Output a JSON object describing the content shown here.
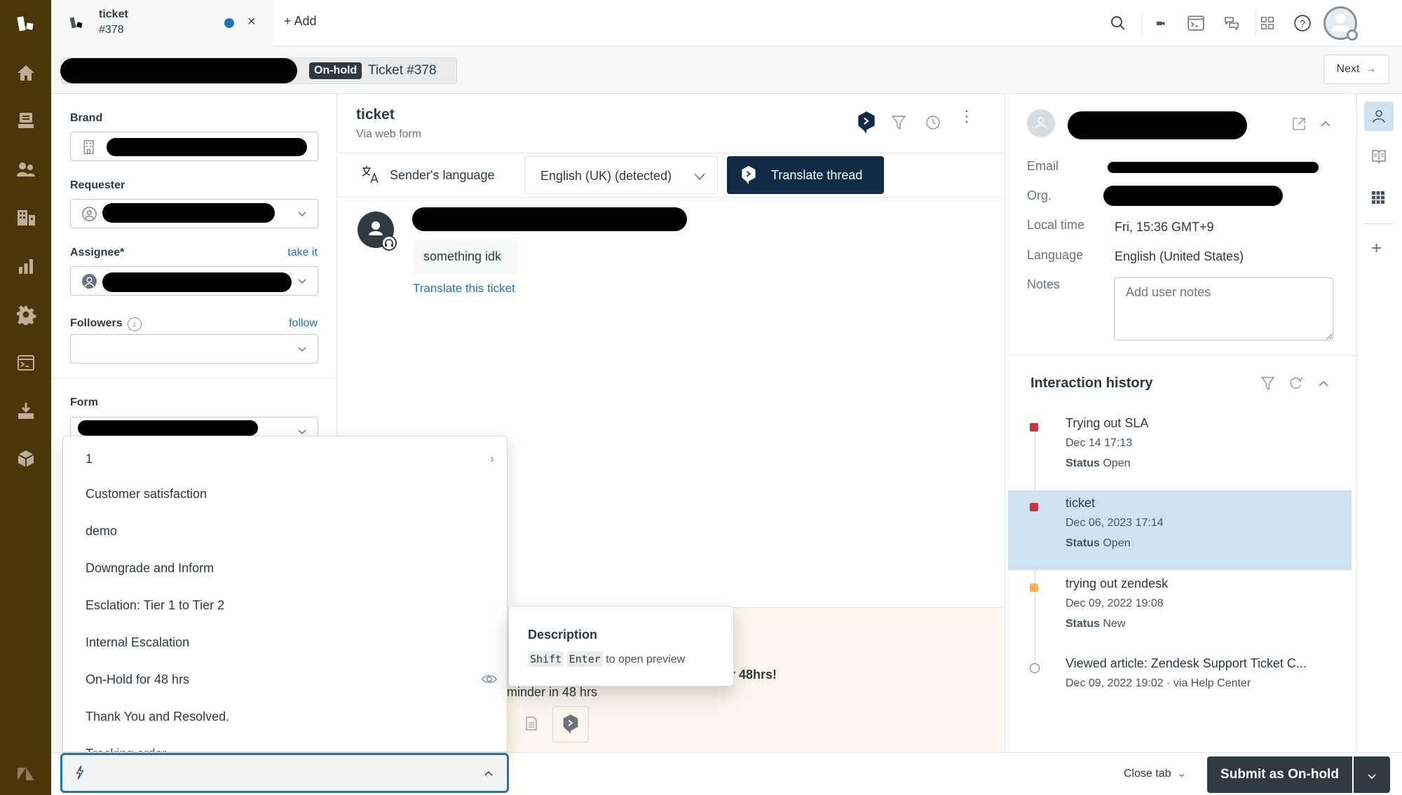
{
  "app": {
    "tab": {
      "title": "ticket",
      "number": "#378",
      "unsaved_indicator_color": "#1f73b7"
    },
    "add_label": "Add"
  },
  "nav": {
    "items": [
      "home-icon",
      "views-icon",
      "customers-icon",
      "organizations-icon",
      "reporting-icon",
      "admin-icon",
      "console-icon",
      "import-icon",
      "apps-icon"
    ],
    "bg_color": "#4a3609"
  },
  "topbar": {
    "icons": [
      "search-icon",
      "video-icon",
      "terminal-icon",
      "conversations-icon",
      "product-grid-icon",
      "help-icon",
      "profile-avatar"
    ]
  },
  "subbar": {
    "status_badge": "On-hold",
    "ticket_label": "Ticket #378",
    "next_label": "Next"
  },
  "props": {
    "brand_label": "Brand",
    "requester_label": "Requester",
    "assignee_label": "Assignee*",
    "take_it": "take it",
    "followers_label": "Followers",
    "follow": "follow",
    "form_label": "Form"
  },
  "conversation": {
    "title": "ticket",
    "via": "Via web form",
    "translate_bar": {
      "sender_language_label": "Sender's language",
      "detected_language": "English (UK) (detected)",
      "translate_thread": "Translate thread"
    },
    "message": {
      "body": "something idk",
      "translate_link": "Translate this ticket"
    },
    "composer": {
      "partial_bold": "r 48hrs!",
      "partial_text": "minder in 48 hrs"
    }
  },
  "macro_menu": {
    "items": [
      {
        "label": "1",
        "has_submenu": true
      },
      {
        "label": "Customer satisfaction"
      },
      {
        "label": "demo"
      },
      {
        "label": "Downgrade and Inform"
      },
      {
        "label": "Esclation: Tier 1 to Tier 2"
      },
      {
        "label": "Internal Escalation"
      },
      {
        "label": "On-Hold for 48 hrs",
        "hovered": true
      },
      {
        "label": "Thank You and Resolved."
      },
      {
        "label": "Tracking order"
      }
    ],
    "input_value": ""
  },
  "tooltip": {
    "title": "Description",
    "key1": "Shift",
    "key2": "Enter",
    "hint": "to open preview"
  },
  "user_panel": {
    "email_label": "Email",
    "org_label": "Org.",
    "local_time_label": "Local time",
    "local_time": "Fri, 15:36 GMT+9",
    "language_label": "Language",
    "language": "English (United States)",
    "notes_label": "Notes",
    "notes_placeholder": "Add user notes"
  },
  "history": {
    "title": "Interaction history",
    "items": [
      {
        "title": "Trying out SLA",
        "date": "Dec 14 17:13",
        "status_label": "Status",
        "status": "Open",
        "color": "#cc3340",
        "selected": false
      },
      {
        "title": "ticket",
        "date": "Dec 06, 2023 17:14",
        "status_label": "Status",
        "status": "Open",
        "color": "#cc3340",
        "selected": true
      },
      {
        "title": "trying out zendesk",
        "date": "Dec 09, 2022 19:08",
        "status_label": "Status",
        "status": "New",
        "color": "#ffb057",
        "selected": false
      },
      {
        "title": "Viewed article: Zendesk Support Ticket C...",
        "date": "Dec 09, 2022 19:02 · via Help Center",
        "color": "",
        "selected": false
      }
    ]
  },
  "bottom": {
    "close_tab": "Close tab",
    "submit": "Submit as On-hold"
  }
}
